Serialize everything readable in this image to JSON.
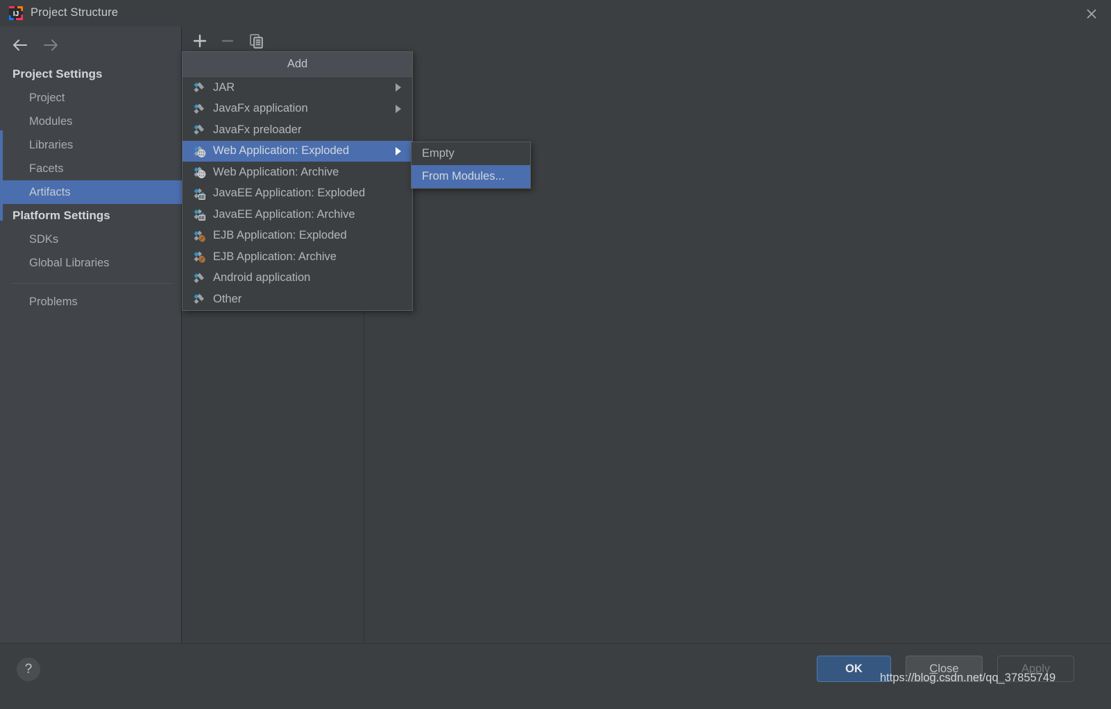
{
  "window": {
    "title": "Project Structure",
    "logo_icon": "intellij-idea-logo",
    "close_icon": "close-icon"
  },
  "navigation": {
    "back_icon": "arrow-left-icon",
    "forward_icon": "arrow-right-icon"
  },
  "sidebar": {
    "groups": [
      {
        "label": "Project Settings",
        "items": [
          {
            "label": "Project",
            "selected": false
          },
          {
            "label": "Modules",
            "selected": false
          },
          {
            "label": "Libraries",
            "selected": false
          },
          {
            "label": "Facets",
            "selected": false
          },
          {
            "label": "Artifacts",
            "selected": true
          }
        ]
      },
      {
        "label": "Platform Settings",
        "items": [
          {
            "label": "SDKs",
            "selected": false
          },
          {
            "label": "Global Libraries",
            "selected": false
          }
        ]
      }
    ],
    "footer_items": [
      {
        "label": "Problems",
        "selected": false
      }
    ]
  },
  "toolbar": {
    "buttons": [
      {
        "name": "add-button",
        "icon": "plus-icon",
        "enabled": true
      },
      {
        "name": "remove-button",
        "icon": "minus-icon",
        "enabled": false
      },
      {
        "name": "copy-button",
        "icon": "copy-icon",
        "enabled": true
      }
    ]
  },
  "add_menu": {
    "header": "Add",
    "items": [
      {
        "label": "JAR",
        "icon": "artifact-icon",
        "submenu": true,
        "selected": false
      },
      {
        "label": "JavaFx application",
        "icon": "artifact-icon",
        "submenu": true,
        "selected": false
      },
      {
        "label": "JavaFx preloader",
        "icon": "artifact-icon",
        "submenu": false,
        "selected": false
      },
      {
        "label": "Web Application: Exploded",
        "icon": "artifact-web-icon",
        "submenu": true,
        "selected": true
      },
      {
        "label": "Web Application: Archive",
        "icon": "artifact-web-icon",
        "submenu": false,
        "selected": false
      },
      {
        "label": "JavaEE Application: Exploded",
        "icon": "artifact-javaee-icon",
        "submenu": false,
        "selected": false
      },
      {
        "label": "JavaEE Application: Archive",
        "icon": "artifact-javaee-icon",
        "submenu": false,
        "selected": false
      },
      {
        "label": "EJB Application: Exploded",
        "icon": "artifact-ejb-icon",
        "submenu": false,
        "selected": false
      },
      {
        "label": "EJB Application: Archive",
        "icon": "artifact-ejb-icon",
        "submenu": false,
        "selected": false
      },
      {
        "label": "Android application",
        "icon": "artifact-icon",
        "submenu": false,
        "selected": false
      },
      {
        "label": "Other",
        "icon": "artifact-icon",
        "submenu": false,
        "selected": false
      }
    ]
  },
  "submenu": {
    "items": [
      {
        "label": "Empty",
        "selected": false
      },
      {
        "label": "From Modules...",
        "selected": true
      }
    ]
  },
  "bottom_bar": {
    "help_label": "?",
    "buttons": [
      {
        "name": "ok-button",
        "label": "OK",
        "enabled": true,
        "primary": true
      },
      {
        "name": "close-button",
        "label": "Close",
        "enabled": true,
        "primary": false,
        "mnemonic": "C"
      },
      {
        "name": "apply-button",
        "label": "Apply",
        "enabled": false,
        "primary": false
      }
    ]
  },
  "watermark": {
    "text": "https://blog.csdn.net/qq_37855749"
  },
  "colors": {
    "background": "#3c3f41",
    "sidebar": "#414549",
    "selection": "#4b6eaf",
    "accent_cyan": "#3592c4",
    "primary_button": "#365880"
  }
}
